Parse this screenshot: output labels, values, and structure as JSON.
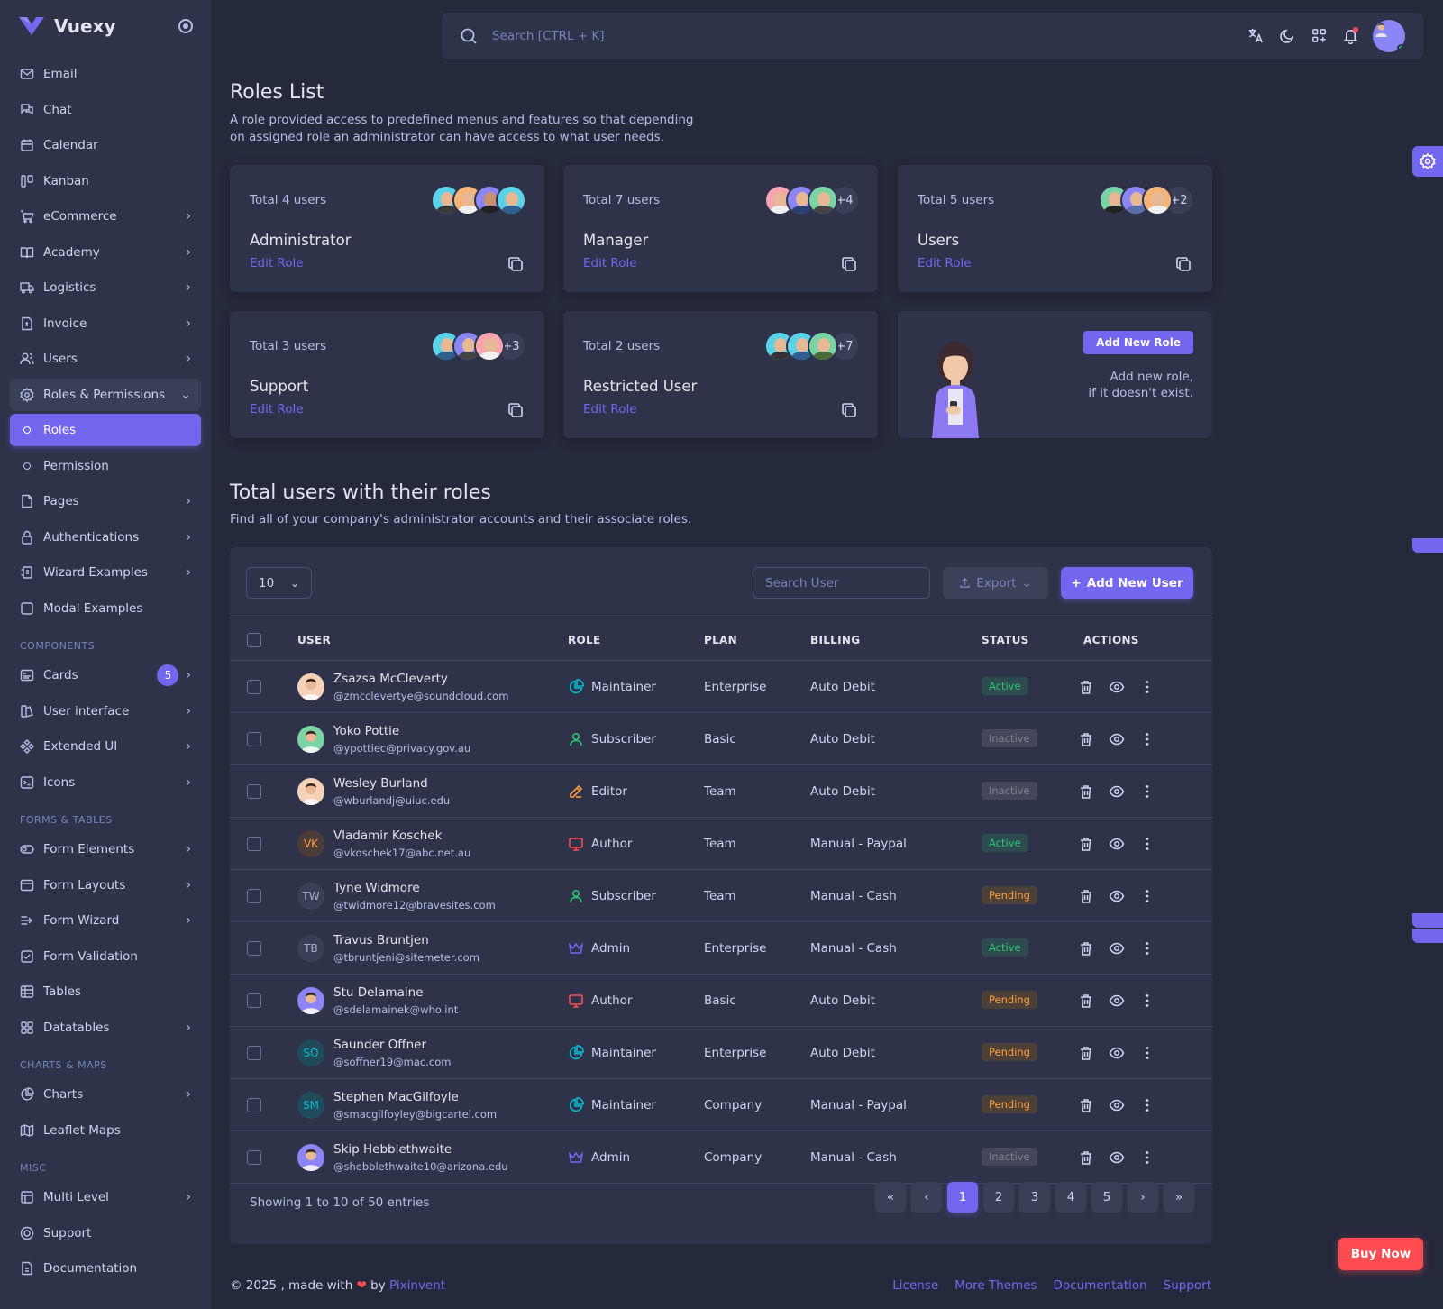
{
  "brand": {
    "name": "Vuexy"
  },
  "sidebar": {
    "items": [
      {
        "label": "Email",
        "icon": "mail-icon"
      },
      {
        "label": "Chat",
        "icon": "chat-icon"
      },
      {
        "label": "Calendar",
        "icon": "calendar-icon"
      },
      {
        "label": "Kanban",
        "icon": "kanban-icon"
      },
      {
        "label": "eCommerce",
        "icon": "cart-icon"
      },
      {
        "label": "Academy",
        "icon": "book-icon"
      },
      {
        "label": "Logistics",
        "icon": "truck-icon"
      },
      {
        "label": "Invoice",
        "icon": "invoice-icon"
      },
      {
        "label": "Users",
        "icon": "users-icon"
      },
      {
        "label": "Roles & Permissions",
        "icon": "settings-icon"
      },
      {
        "label": "Roles"
      },
      {
        "label": "Permission"
      },
      {
        "label": "Pages",
        "icon": "file-icon"
      },
      {
        "label": "Authentications",
        "icon": "lock-icon"
      },
      {
        "label": "Wizard Examples",
        "icon": "wizard-icon"
      },
      {
        "label": "Modal Examples",
        "icon": "square-icon"
      }
    ],
    "section_components": "COMPONENTS",
    "components": [
      {
        "label": "Cards",
        "badge": "5"
      },
      {
        "label": "User interface"
      },
      {
        "label": "Extended UI"
      },
      {
        "label": "Icons"
      }
    ],
    "section_forms": "FORMS & TABLES",
    "forms": [
      {
        "label": "Form Elements"
      },
      {
        "label": "Form Layouts"
      },
      {
        "label": "Form Wizard"
      },
      {
        "label": "Form Validation"
      },
      {
        "label": "Tables"
      },
      {
        "label": "Datatables"
      }
    ],
    "section_charts": "CHARTS & MAPS",
    "charts": [
      {
        "label": "Charts"
      },
      {
        "label": "Leaflet Maps"
      }
    ],
    "section_misc": "MISC",
    "misc": [
      {
        "label": "Multi Level"
      },
      {
        "label": "Support"
      },
      {
        "label": "Documentation"
      }
    ]
  },
  "topbar": {
    "search_placeholder": "Search [CTRL + K]"
  },
  "page": {
    "title": "Roles List",
    "subtitle": "A role provided access to predefined menus and features so that depending on assigned role an administrator can have access to what user needs."
  },
  "roles": [
    {
      "total": "Total 4 users",
      "name": "Administrator",
      "edit": "Edit Role",
      "more": ""
    },
    {
      "total": "Total 7 users",
      "name": "Manager",
      "edit": "Edit Role",
      "more": "+4"
    },
    {
      "total": "Total 5 users",
      "name": "Users",
      "edit": "Edit Role",
      "more": "+2"
    },
    {
      "total": "Total 3 users",
      "name": "Support",
      "edit": "Edit Role",
      "more": "+3"
    },
    {
      "total": "Total 2 users",
      "name": "Restricted User",
      "edit": "Edit Role",
      "more": "+7"
    }
  ],
  "add_role": {
    "button": "Add New Role",
    "text_line1": "Add new role,",
    "text_line2": "if it doesn't exist."
  },
  "users_section": {
    "title": "Total users with their roles",
    "subtitle": "Find all of your company's administrator accounts and their associate roles."
  },
  "table": {
    "page_length": "10",
    "search_placeholder": "Search User",
    "export_label": "Export",
    "add_user_label": "Add New User",
    "headers": [
      "USER",
      "ROLE",
      "PLAN",
      "BILLING",
      "STATUS",
      "ACTIONS"
    ],
    "rows": [
      {
        "name": "Zsazsa McCleverty",
        "email": "@zmcclevertye@soundcloud.com",
        "initials": "",
        "role": "Maintainer",
        "plan": "Enterprise",
        "billing": "Auto Debit",
        "status": "Active"
      },
      {
        "name": "Yoko Pottie",
        "email": "@ypottiec@privacy.gov.au",
        "initials": "",
        "role": "Subscriber",
        "plan": "Basic",
        "billing": "Auto Debit",
        "status": "Inactive"
      },
      {
        "name": "Wesley Burland",
        "email": "@wburlandj@uiuc.edu",
        "initials": "",
        "role": "Editor",
        "plan": "Team",
        "billing": "Auto Debit",
        "status": "Inactive"
      },
      {
        "name": "Vladamir Koschek",
        "email": "@vkoschek17@abc.net.au",
        "initials": "VK",
        "role": "Author",
        "plan": "Team",
        "billing": "Manual - Paypal",
        "status": "Active"
      },
      {
        "name": "Tyne Widmore",
        "email": "@twidmore12@bravesites.com",
        "initials": "TW",
        "role": "Subscriber",
        "plan": "Team",
        "billing": "Manual - Cash",
        "status": "Pending"
      },
      {
        "name": "Travus Bruntjen",
        "email": "@tbruntjeni@sitemeter.com",
        "initials": "TB",
        "role": "Admin",
        "plan": "Enterprise",
        "billing": "Manual - Cash",
        "status": "Active"
      },
      {
        "name": "Stu Delamaine",
        "email": "@sdelamainek@who.int",
        "initials": "",
        "role": "Author",
        "plan": "Basic",
        "billing": "Auto Debit",
        "status": "Pending"
      },
      {
        "name": "Saunder Offner",
        "email": "@soffner19@mac.com",
        "initials": "SO",
        "role": "Maintainer",
        "plan": "Enterprise",
        "billing": "Auto Debit",
        "status": "Pending"
      },
      {
        "name": "Stephen MacGilfoyle",
        "email": "@smacgilfoyley@bigcartel.com",
        "initials": "SM",
        "role": "Maintainer",
        "plan": "Company",
        "billing": "Manual - Paypal",
        "status": "Pending"
      },
      {
        "name": "Skip Hebblethwaite",
        "email": "@shebblethwaite10@arizona.edu",
        "initials": "",
        "role": "Admin",
        "plan": "Company",
        "billing": "Manual - Cash",
        "status": "Inactive"
      }
    ],
    "showing": "Showing 1 to 10 of 50 entries",
    "pages": [
      "1",
      "2",
      "3",
      "4",
      "5"
    ]
  },
  "footer": {
    "copyright": "© 2025 , made with",
    "heart": "❤",
    "by": "by",
    "company": "Pixinvent",
    "links": [
      "License",
      "More Themes",
      "Documentation",
      "Support"
    ]
  },
  "buy_now": "Buy Now",
  "colors": {
    "primary": "#7367f0",
    "active": "#28c76f",
    "pending": "#ff9f43",
    "inactive": "#808390",
    "danger": "#ff4c51"
  }
}
